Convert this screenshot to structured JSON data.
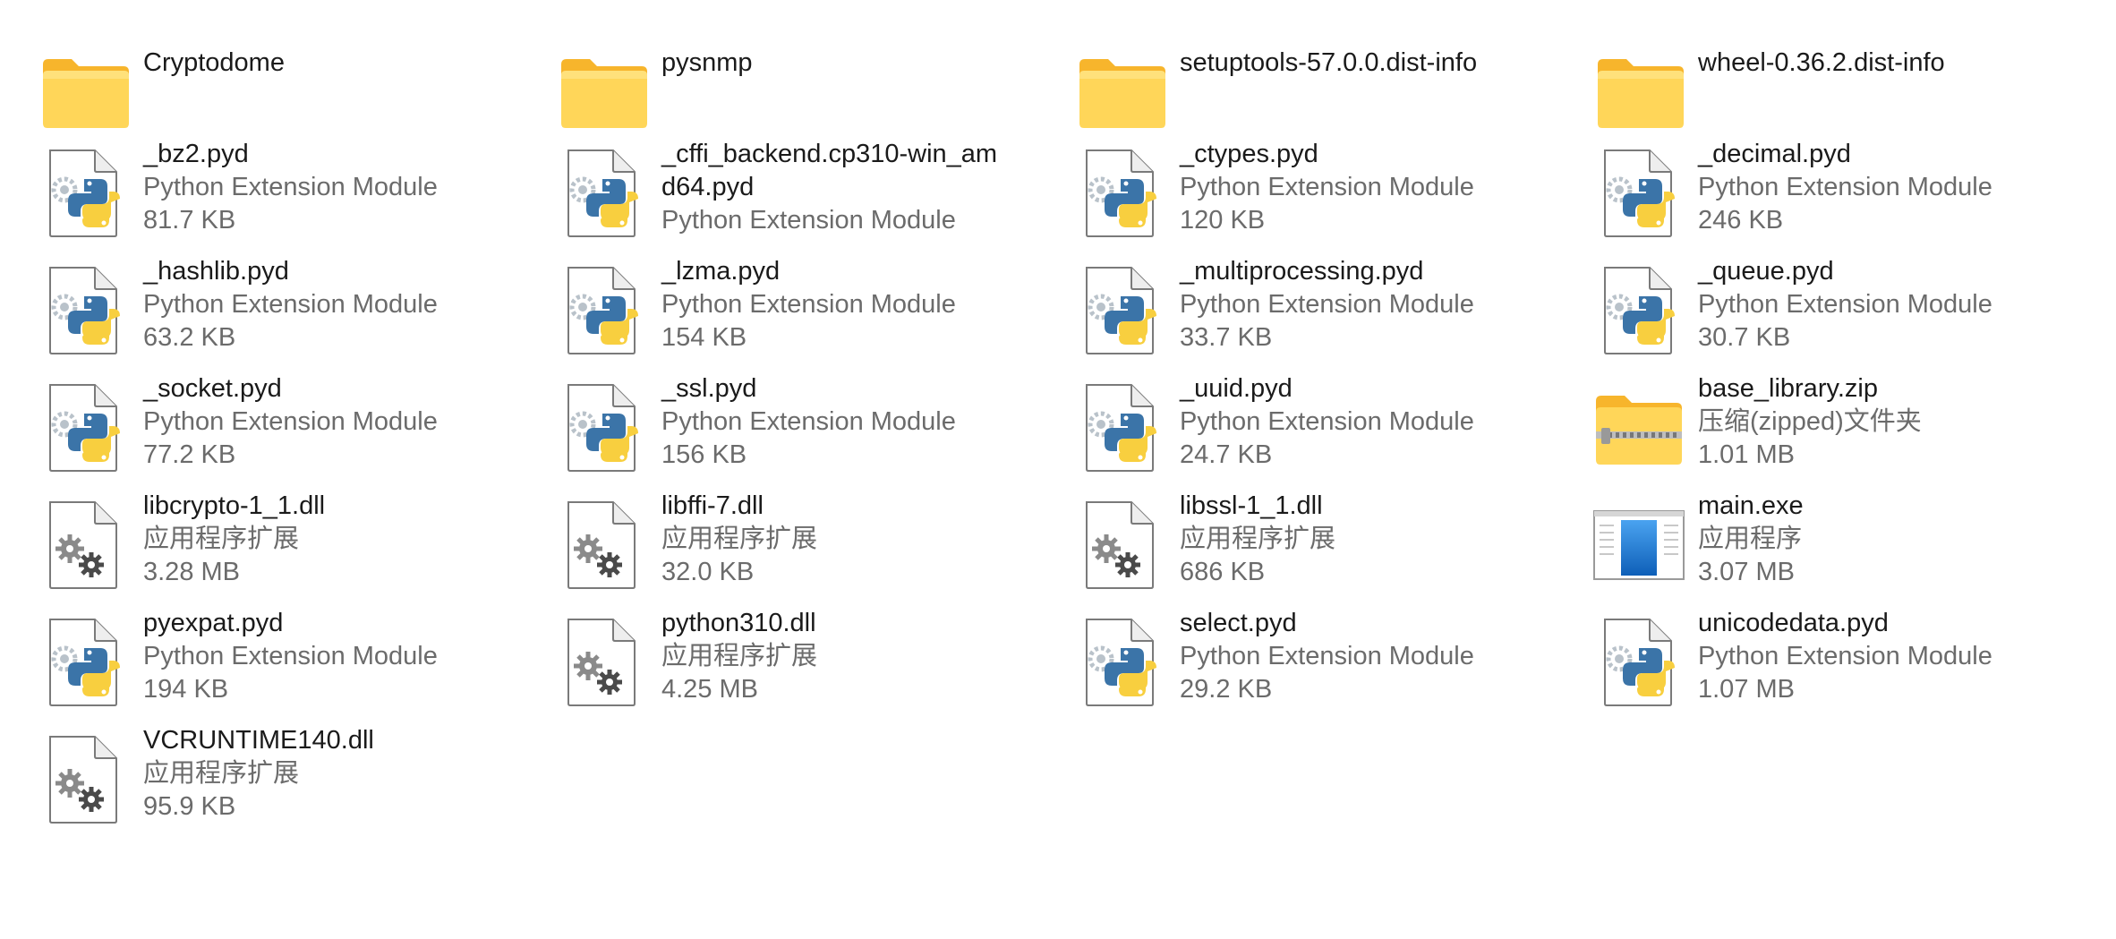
{
  "folders": [
    {
      "name": "Cryptodome"
    },
    {
      "name": "pysnmp"
    },
    {
      "name": "setuptools-57.0.0.dist-info"
    },
    {
      "name": "wheel-0.36.2.dist-info"
    }
  ],
  "files": [
    {
      "name": "_bz2.pyd",
      "type": "Python Extension Module",
      "size": "81.7 KB",
      "icon": "python-file-icon"
    },
    {
      "name": "_cffi_backend.cp310-win_amd64.pyd",
      "type": "Python Extension Module",
      "size": "",
      "icon": "python-file-icon"
    },
    {
      "name": "_ctypes.pyd",
      "type": "Python Extension Module",
      "size": "120 KB",
      "icon": "python-file-icon"
    },
    {
      "name": "_decimal.pyd",
      "type": "Python Extension Module",
      "size": "246 KB",
      "icon": "python-file-icon"
    },
    {
      "name": "_hashlib.pyd",
      "type": "Python Extension Module",
      "size": "63.2 KB",
      "icon": "python-file-icon"
    },
    {
      "name": "_lzma.pyd",
      "type": "Python Extension Module",
      "size": "154 KB",
      "icon": "python-file-icon"
    },
    {
      "name": "_multiprocessing.pyd",
      "type": "Python Extension Module",
      "size": "33.7 KB",
      "icon": "python-file-icon"
    },
    {
      "name": "_queue.pyd",
      "type": "Python Extension Module",
      "size": "30.7 KB",
      "icon": "python-file-icon"
    },
    {
      "name": "_socket.pyd",
      "type": "Python Extension Module",
      "size": "77.2 KB",
      "icon": "python-file-icon"
    },
    {
      "name": "_ssl.pyd",
      "type": "Python Extension Module",
      "size": "156 KB",
      "icon": "python-file-icon"
    },
    {
      "name": "_uuid.pyd",
      "type": "Python Extension Module",
      "size": "24.7 KB",
      "icon": "python-file-icon"
    },
    {
      "name": "base_library.zip",
      "type": "压缩(zipped)文件夹",
      "size": "1.01 MB",
      "icon": "zip-folder-icon"
    },
    {
      "name": "libcrypto-1_1.dll",
      "type": "应用程序扩展",
      "size": "3.28 MB",
      "icon": "dll-file-icon"
    },
    {
      "name": "libffi-7.dll",
      "type": "应用程序扩展",
      "size": "32.0 KB",
      "icon": "dll-file-icon"
    },
    {
      "name": "libssl-1_1.dll",
      "type": "应用程序扩展",
      "size": "686 KB",
      "icon": "dll-file-icon"
    },
    {
      "name": "main.exe",
      "type": "应用程序",
      "size": "3.07 MB",
      "icon": "exe-file-icon"
    },
    {
      "name": "pyexpat.pyd",
      "type": "Python Extension Module",
      "size": "194 KB",
      "icon": "python-file-icon"
    },
    {
      "name": "python310.dll",
      "type": "应用程序扩展",
      "size": "4.25 MB",
      "icon": "dll-file-icon"
    },
    {
      "name": "select.pyd",
      "type": "Python Extension Module",
      "size": "29.2 KB",
      "icon": "python-file-icon"
    },
    {
      "name": "unicodedata.pyd",
      "type": "Python Extension Module",
      "size": "1.07 MB",
      "icon": "python-file-icon"
    },
    {
      "name": "VCRUNTIME140.dll",
      "type": "应用程序扩展",
      "size": "95.9 KB",
      "icon": "dll-file-icon"
    }
  ],
  "colors": {
    "folder_front": "#FFD659",
    "folder_back": "#F7B52C",
    "python_blue": "#3B74A8",
    "python_yellow": "#F8CF3F",
    "primary_text": "#1a1a1a",
    "secondary_text": "#6b6b6b"
  }
}
